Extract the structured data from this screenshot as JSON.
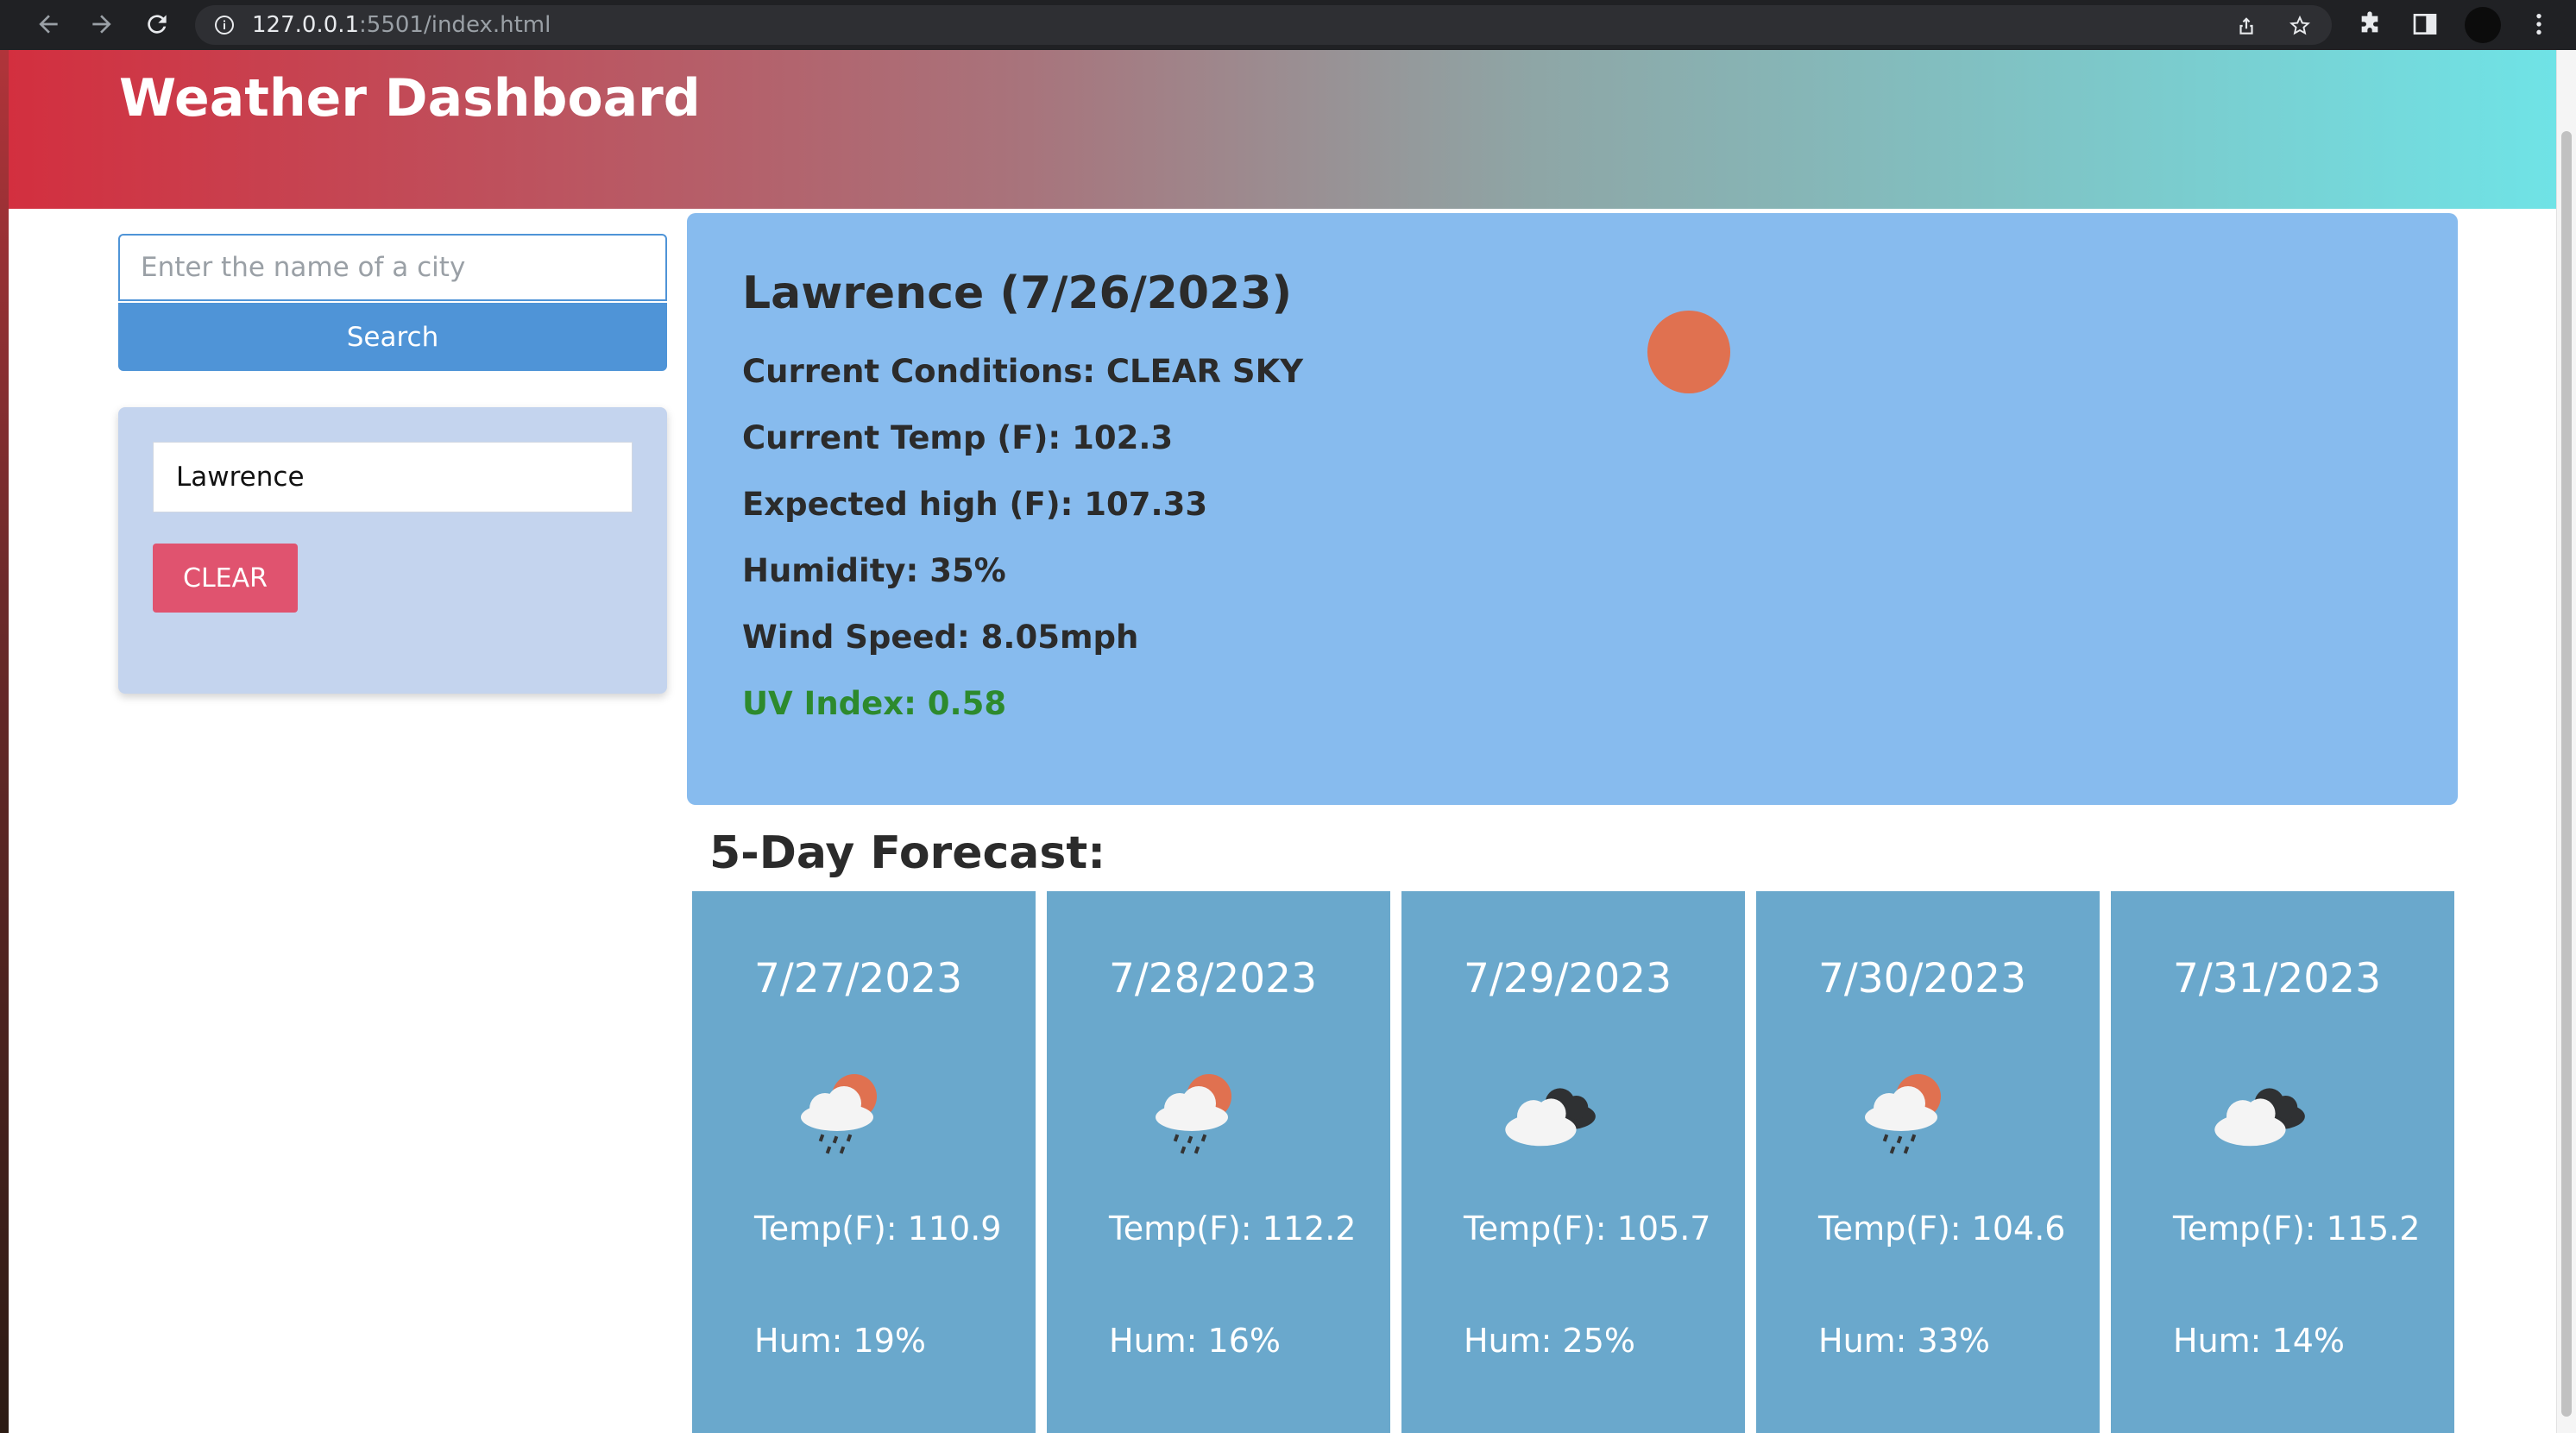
{
  "browser": {
    "url_host": "127.0.0.1",
    "url_rest": ":5501/index.html"
  },
  "header": {
    "title": "Weather Dashboard"
  },
  "search": {
    "placeholder": "Enter the name of a city",
    "value": "",
    "button_label": "Search"
  },
  "history": {
    "items": [
      "Lawrence"
    ],
    "clear_label": "CLEAR"
  },
  "current": {
    "title": "Lawrence (7/26/2023)",
    "conditions": "Current Conditions: CLEAR SKY",
    "temp": "Current Temp (F): 102.3",
    "high": "Expected high (F): 107.33",
    "humidity": "Humidity: 35%",
    "wind": "Wind Speed: 8.05mph",
    "uv": "UV Index: 0.58",
    "icon": "clear-sky-sun-icon",
    "uv_color": "#2d8a2d"
  },
  "forecast": {
    "title": "5-Day Forecast:",
    "days": [
      {
        "date": "7/27/2023",
        "icon": "rain-cloud-sun-icon",
        "temp": "Temp(F): 110.9",
        "hum": "Hum: 19%"
      },
      {
        "date": "7/28/2023",
        "icon": "rain-cloud-sun-icon",
        "temp": "Temp(F): 112.2",
        "hum": "Hum: 16%"
      },
      {
        "date": "7/29/2023",
        "icon": "broken-clouds-icon",
        "temp": "Temp(F): 105.7",
        "hum": "Hum: 25%"
      },
      {
        "date": "7/30/2023",
        "icon": "rain-cloud-sun-icon",
        "temp": "Temp(F): 104.6",
        "hum": "Hum: 33%"
      },
      {
        "date": "7/31/2023",
        "icon": "broken-clouds-icon",
        "temp": "Temp(F): 115.2",
        "hum": "Hum: 14%"
      }
    ]
  },
  "colors": {
    "header_gradient_start": "#d32f3f",
    "header_gradient_end": "#6fe3e6",
    "primary": "#4f94d7",
    "clear_button": "#e0536f",
    "current_card": "#87bbee",
    "forecast_card": "#6aa8cc"
  }
}
